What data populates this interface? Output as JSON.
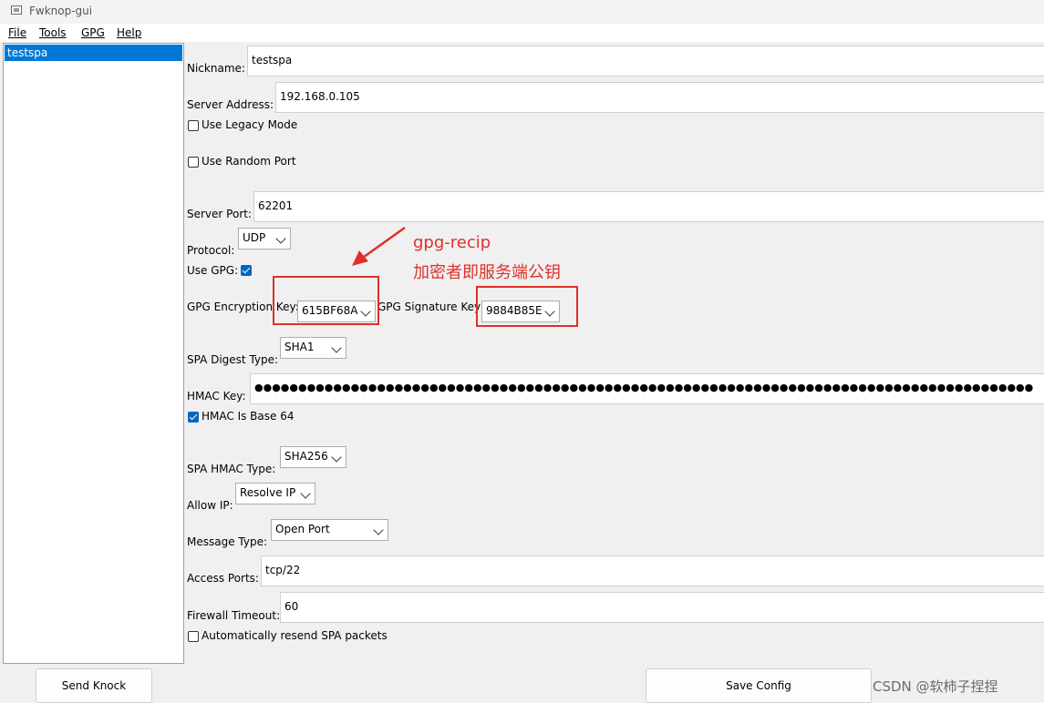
{
  "window": {
    "title": "Fwknop-gui"
  },
  "menu": [
    "File",
    "Tools",
    "GPG",
    "Help"
  ],
  "sidebar": {
    "items": [
      "testspa"
    ]
  },
  "form": {
    "nickname_label": "Nickname:",
    "nickname_value": "testspa",
    "server_address_label": "Server Address:",
    "server_address_value": "192.168.0.105",
    "legacy_mode_label": "Use Legacy Mode",
    "legacy_mode_checked": false,
    "random_port_label": "Use Random Port",
    "random_port_checked": false,
    "server_port_label": "Server Port:",
    "server_port_value": "62201",
    "protocol_label": "Protocol:",
    "protocol_value": "UDP",
    "use_gpg_label": "Use GPG:",
    "use_gpg_checked": true,
    "gpg_enc_label": "GPG Encryption Key:",
    "gpg_enc_value": "615BF68A",
    "gpg_sig_label": "GPG Signature Key",
    "gpg_sig_value": "9884B85E",
    "spa_digest_label": "SPA Digest Type:",
    "spa_digest_value": "SHA1",
    "hmac_key_label": "HMAC Key:",
    "hmac_key_value": "●●●●●●●●●●●●●●●●●●●●●●●●●●●●●●●●●●●●●●●●●●●●●●●●●●●●●●●●●●●●●●●●●●●●●●●●●●●●●●●●●●●●●●●●●",
    "hmac_base64_label": "HMAC Is Base 64",
    "hmac_base64_checked": true,
    "spa_hmac_label": "SPA HMAC Type:",
    "spa_hmac_value": "SHA256",
    "allow_ip_label": "Allow IP:",
    "allow_ip_value": "Resolve IP",
    "message_type_label": "Message Type:",
    "message_type_value": "Open Port",
    "access_ports_label": "Access Ports:",
    "access_ports_value": "tcp/22",
    "firewall_timeout_label": "Firewall Timeout:",
    "firewall_timeout_value": "60",
    "auto_resend_label": "Automatically resend SPA packets",
    "auto_resend_checked": false
  },
  "buttons": {
    "send_knock": "Send Knock",
    "save_config": "Save Config"
  },
  "annotation": {
    "line1": "gpg-recip",
    "line2": "加密者即服务端公钥"
  },
  "watermark": "CSDN @软柿子捏捏",
  "colors": {
    "annotation": "#e0302a",
    "selection": "#0078d7",
    "checkbox_checked": "#0067c0"
  }
}
